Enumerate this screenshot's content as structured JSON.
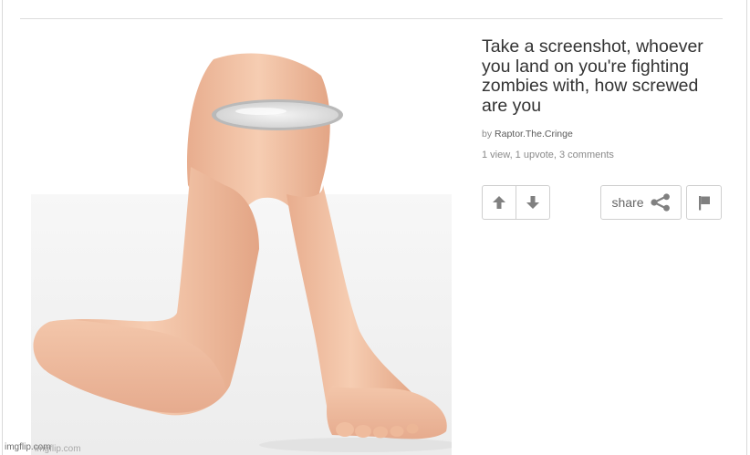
{
  "post": {
    "title": "Take a screenshot, whoever you land on you're fighting zombies with, how screwed are you",
    "by_prefix": "by",
    "author": "Raptor.The.Cringe",
    "stats": "1 view, 1 upvote, 3 comments"
  },
  "image": {
    "alt": "Legs meme with among us visor",
    "watermark_primary": "imgflip.com",
    "watermark_secondary": "imgflip.com"
  },
  "actions": {
    "upvote_icon": "arrow-up-icon",
    "downvote_icon": "arrow-down-icon",
    "share_label": "share",
    "share_icon": "share-icon",
    "flag_icon": "flag-icon"
  },
  "colors": {
    "skin": "#f2c4a8",
    "icon": "#808080",
    "border": "#cfcfcf",
    "title": "#333333"
  }
}
